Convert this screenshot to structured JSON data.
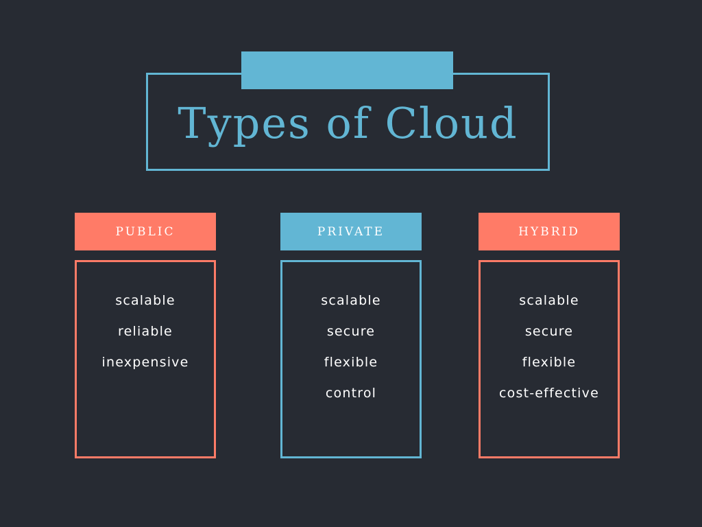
{
  "title": "Types of Cloud",
  "colors": {
    "background": "#272b33",
    "blue": "#62b6d4",
    "coral": "#ff7b67",
    "text": "#ffffff"
  },
  "columns": [
    {
      "header": "PUBLIC",
      "items": [
        "scalable",
        "reliable",
        "inexpensive"
      ]
    },
    {
      "header": "PRIVATE",
      "items": [
        "scalable",
        "secure",
        "flexible",
        "control"
      ]
    },
    {
      "header": "HYBRID",
      "items": [
        "scalable",
        "secure",
        "flexible",
        "cost-effective"
      ]
    }
  ]
}
